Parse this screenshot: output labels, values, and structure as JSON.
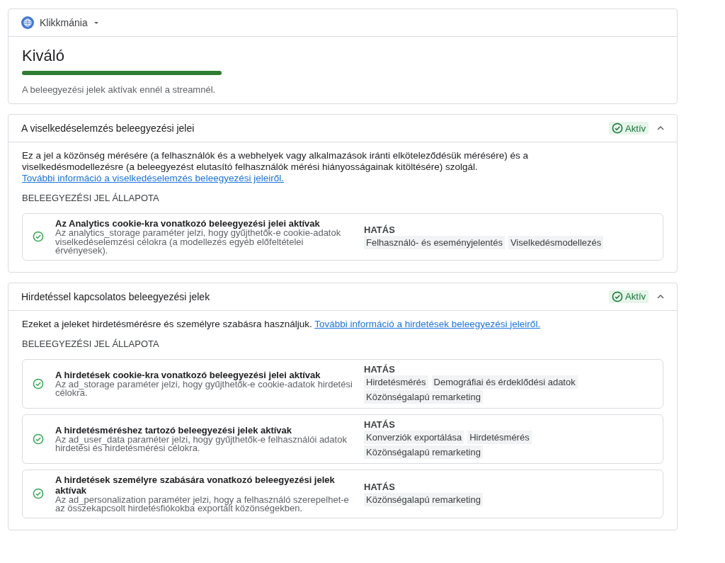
{
  "property": {
    "name": "Klikkmánia"
  },
  "overall": {
    "title": "Kiváló",
    "level": 1,
    "message": "A beleegyezési jelek aktívak ennél a streamnél."
  },
  "sections": [
    {
      "title": "A viselkedéselemzés beleegyezési jelei",
      "status": "Aktív",
      "active": true,
      "expanded": true,
      "description": "Ez a jel a közönség mérésére (a felhasználók és a webhelyek vagy alkalmazások iránti elköteleződésük mérésére) és a viselkedésmodellezésre (a beleegyezést elutasító felhasználók mérési hiányosságainak kitöltésére) szolgál.",
      "link": "További információ a viselkedéselemzés beleegyezési jeleiről.",
      "status_heading": "BELEEGYEZÉSI JEL ÁLLAPOTA",
      "signals": [
        {
          "title": "Az Analytics cookie-kra vonatkozó beleegyezési jelei aktívak",
          "description": "Az analytics_storage paraméter jelzi, hogy gyűjthetők-e cookie-adatok viselkedéselemzési célokra (a modellezés egyéb előfeltételei érvényesek).",
          "active": true,
          "impact_label": "HATÁS",
          "impacts": [
            "Felhasználó- és eseményjelentés",
            "Viselkedésmodellezés"
          ]
        }
      ]
    },
    {
      "title": "Hirdetéssel kapcsolatos beleegyezési jelek",
      "status": "Aktív",
      "active": true,
      "expanded": true,
      "description": "Ezeket a jeleket hirdetésmérésre és személyre szabásra használjuk.",
      "link": "További információ a hirdetések beleegyezési jeleiről.",
      "status_heading": "BELEEGYEZÉSI JEL ÁLLAPOTA",
      "signals": [
        {
          "title": "A hirdetések cookie-kra vonatkozó beleegyezési jelei aktívak",
          "description": "Az ad_storage paraméter jelzi, hogy gyűjthetők-e cookie-adatok hirdetési célokra.",
          "active": true,
          "impact_label": "HATÁS",
          "impacts": [
            "Hirdetésmérés",
            "Demográfiai és érdeklődési adatok",
            "Közönségalapú remarketing"
          ]
        },
        {
          "title": "A hirdetésméréshez tartozó beleegyezési jelek aktívak",
          "description": "Az ad_user_data paraméter jelzi, hogy gyűjthetők-e felhasználói adatok hirdetési és hirdetésmérési célokra.",
          "active": true,
          "impact_label": "HATÁS",
          "impacts": [
            "Konverziók exportálása",
            "Hirdetésmérés",
            "Közönségalapú remarketing"
          ]
        },
        {
          "title": "A hirdetések személyre szabására vonatkozó beleegyezési jelek aktívak",
          "description": "Az ad_personalization paraméter jelzi, hogy a felhasználó szerepelhet-e az összekapcsolt hirdetésfiókokba exportált közönségekben.",
          "active": true,
          "impact_label": "HATÁS",
          "impacts": [
            "Közönségalapú remarketing"
          ]
        }
      ]
    }
  ]
}
